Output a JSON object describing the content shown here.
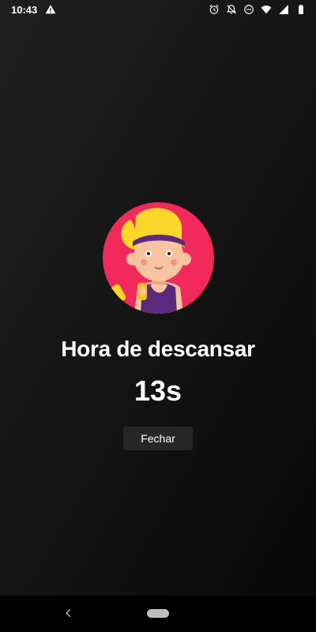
{
  "status_bar": {
    "time": "10:43",
    "left_icons": [
      "warning-icon"
    ],
    "right_icons": [
      "alarm-icon",
      "notifications-off-icon",
      "do-not-disturb-icon",
      "wifi-icon",
      "signal-icon",
      "battery-icon"
    ]
  },
  "rest_screen": {
    "title": "Hora de descansar",
    "timer": "13s",
    "close_button_label": "Fechar",
    "avatar_icon": "fitness-girl-avatar-icon"
  },
  "navigation_bar": {
    "back_icon": "back-chevron-icon",
    "home_icon": "home-pill-icon"
  },
  "colors": {
    "avatar_background": "#f2295b",
    "hair": "#f9d62a",
    "headband": "#5b2a7c",
    "button_background": "#262626",
    "text": "#ffffff"
  }
}
